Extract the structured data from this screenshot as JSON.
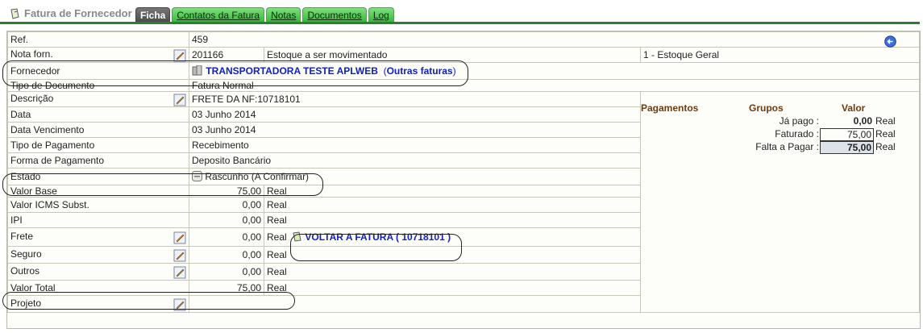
{
  "header": {
    "title": "Fatura de Fornecedor",
    "tabs": [
      {
        "label": "Ficha",
        "active": true
      },
      {
        "label": "Contatos da Fatura"
      },
      {
        "label": "Notas"
      },
      {
        "label": "Documentos"
      },
      {
        "label": "Log"
      }
    ]
  },
  "fields": {
    "ref": {
      "label": "Ref.",
      "value": "459"
    },
    "nota": {
      "label": "Nota forn.",
      "value": "201166",
      "estoque": "Estoque a ser movimentado",
      "estoque_value": "1 - Estoque Geral"
    },
    "fornecedor": {
      "label": "Fornecedor",
      "value": "TRANSPORTADORA TESTE APLWEB",
      "outras_open": "(",
      "outras": "Outras faturas",
      "outras_close": ")"
    },
    "tipo_doc": {
      "label": "Tipo de Documento",
      "value": "Fatura Normal"
    },
    "descricao": {
      "label": "Descrição",
      "value": "FRETE DA NF:10718101"
    },
    "data": {
      "label": "Data",
      "value": "03 Junho 2014"
    },
    "data_venc": {
      "label": "Data Vencimento",
      "value": "03 Junho 2014"
    },
    "tipo_pag": {
      "label": "Tipo de Pagamento",
      "value": "Recebimento"
    },
    "forma_pag": {
      "label": "Forma de Pagamento",
      "value": "Deposito Bancário"
    },
    "estado": {
      "label": "Estado",
      "value": "Rascunho (A Confirmar)"
    },
    "valor_base": {
      "label": "Valor Base",
      "value": "75,00",
      "currency": "Real"
    },
    "valor_icms": {
      "label": "Valor ICMS Subst.",
      "value": "0,00",
      "currency": "Real"
    },
    "ipi": {
      "label": "IPI",
      "value": "0,00",
      "currency": "Real"
    },
    "frete": {
      "label": "Frete",
      "value": "0,00",
      "currency": "Real",
      "link": "VOLTAR A FATURA ( 10718101 )"
    },
    "seguro": {
      "label": "Seguro",
      "value": "0,00",
      "currency": "Real"
    },
    "outros": {
      "label": "Outros",
      "value": "0,00",
      "currency": "Real"
    },
    "valor_total": {
      "label": "Valor Total",
      "value": "75,00",
      "currency": "Real"
    },
    "projeto": {
      "label": "Projeto",
      "value": ""
    }
  },
  "pagamentos": {
    "header_pag": "Pagamentos",
    "header_grupos": "Grupos",
    "header_valor": "Valor",
    "rows": [
      {
        "label": "Já pago :",
        "value": "0,00",
        "currency": "Real"
      },
      {
        "label": "Faturado :",
        "value": "75,00",
        "currency": "Real"
      },
      {
        "label": "Falta a Pagar :",
        "value": "75,00",
        "currency": "Real"
      }
    ]
  }
}
